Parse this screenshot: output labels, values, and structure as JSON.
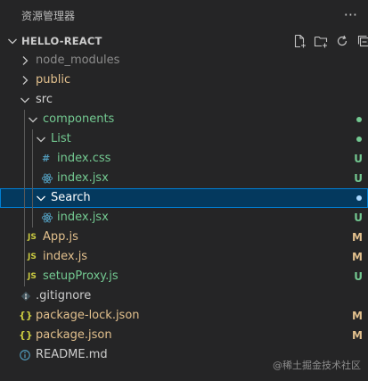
{
  "header": {
    "title": "资源管理器",
    "more_label": "···"
  },
  "section": {
    "title": "HELLO-REACT",
    "actions": [
      {
        "name": "new-file-icon"
      },
      {
        "name": "new-folder-icon"
      },
      {
        "name": "refresh-icon"
      },
      {
        "name": "collapse-all-icon"
      }
    ]
  },
  "tree": {
    "items": [
      {
        "label": "node_modules",
        "kind": "folder",
        "expanded": false,
        "badge": ""
      },
      {
        "label": "public",
        "kind": "folder",
        "expanded": false,
        "badge": ""
      },
      {
        "label": "src",
        "kind": "folder",
        "expanded": true,
        "badge": ""
      },
      {
        "label": "components",
        "kind": "folder",
        "expanded": true,
        "badge": ""
      },
      {
        "label": "List",
        "kind": "folder",
        "expanded": true,
        "badge": ""
      },
      {
        "label": "index.css",
        "kind": "file",
        "icon": "#",
        "badge": "U"
      },
      {
        "label": "index.jsx",
        "kind": "file",
        "icon": "react",
        "badge": "U"
      },
      {
        "label": "Search",
        "kind": "folder",
        "expanded": true,
        "badge": ""
      },
      {
        "label": "index.jsx",
        "kind": "file",
        "icon": "react",
        "badge": "U"
      },
      {
        "label": "App.js",
        "kind": "file",
        "icon": "JS",
        "badge": "M"
      },
      {
        "label": "index.js",
        "kind": "file",
        "icon": "JS",
        "badge": "M"
      },
      {
        "label": "setupProxy.js",
        "kind": "file",
        "icon": "JS",
        "badge": "U"
      },
      {
        "label": ".gitignore",
        "kind": "file",
        "icon": "git",
        "badge": ""
      },
      {
        "label": "package-lock.json",
        "kind": "file",
        "icon": "{ }",
        "badge": "M"
      },
      {
        "label": "package.json",
        "kind": "file",
        "icon": "{ }",
        "badge": "M"
      },
      {
        "label": "README.md",
        "kind": "file",
        "icon": "info",
        "badge": ""
      }
    ]
  },
  "watermark": "@稀土掘金技术社区",
  "colors": {
    "background": "#252526",
    "selected_bg": "#04395e",
    "selected_border": "#007fd4",
    "untracked": "#73c991",
    "modified": "#e2c08d",
    "ignored": "#8c8c8c",
    "js_icon": "#cbcb41",
    "css_icon": "#519aba",
    "json_icon": "#cbcb41"
  }
}
